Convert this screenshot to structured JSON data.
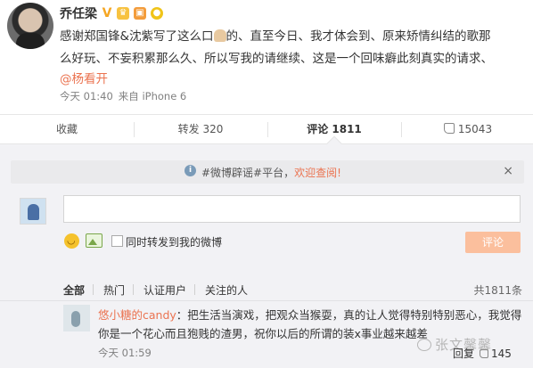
{
  "post": {
    "author": "乔任梁",
    "text_line1_before": "感谢郑国锋&沈紫写了这么口",
    "text_line1_after": "的、直至今日、我才体会到、原来矫情纠结的歌那",
    "text_line2": "么好玩、不妄积累那么久、所以写我的请继续、这是一个回味癖此刻真实的请求、",
    "mention": "@杨看开",
    "time": "今天 01:40",
    "source": "来自 iPhone 6"
  },
  "actions": {
    "favorite": "收藏",
    "forward": "转发 320",
    "comment": "评论 1811",
    "like": "15043"
  },
  "notice": {
    "text_before": "#微博辟谣#平台，",
    "link": "欢迎查阅!",
    "close": "×"
  },
  "composer": {
    "input_value": "",
    "checkbox_label": "同时转发到我的微博",
    "submit_label": "评论"
  },
  "filters": {
    "all": "全部",
    "hot": "热门",
    "verified": "认证用户",
    "following": "关注的人",
    "total": "共1811条"
  },
  "comment": {
    "user": "悠小糖的candy",
    "text": "：把生活当演戏，把观众当猴耍，真的让人觉得特别特别恶心，我觉得你是一个花心而且狍贱的渣男，祝你以后的所谓的装x事业越来越差",
    "time": "今天 01:59",
    "reply": "回复",
    "likes": "145"
  },
  "watermark": "张文馨馨"
}
